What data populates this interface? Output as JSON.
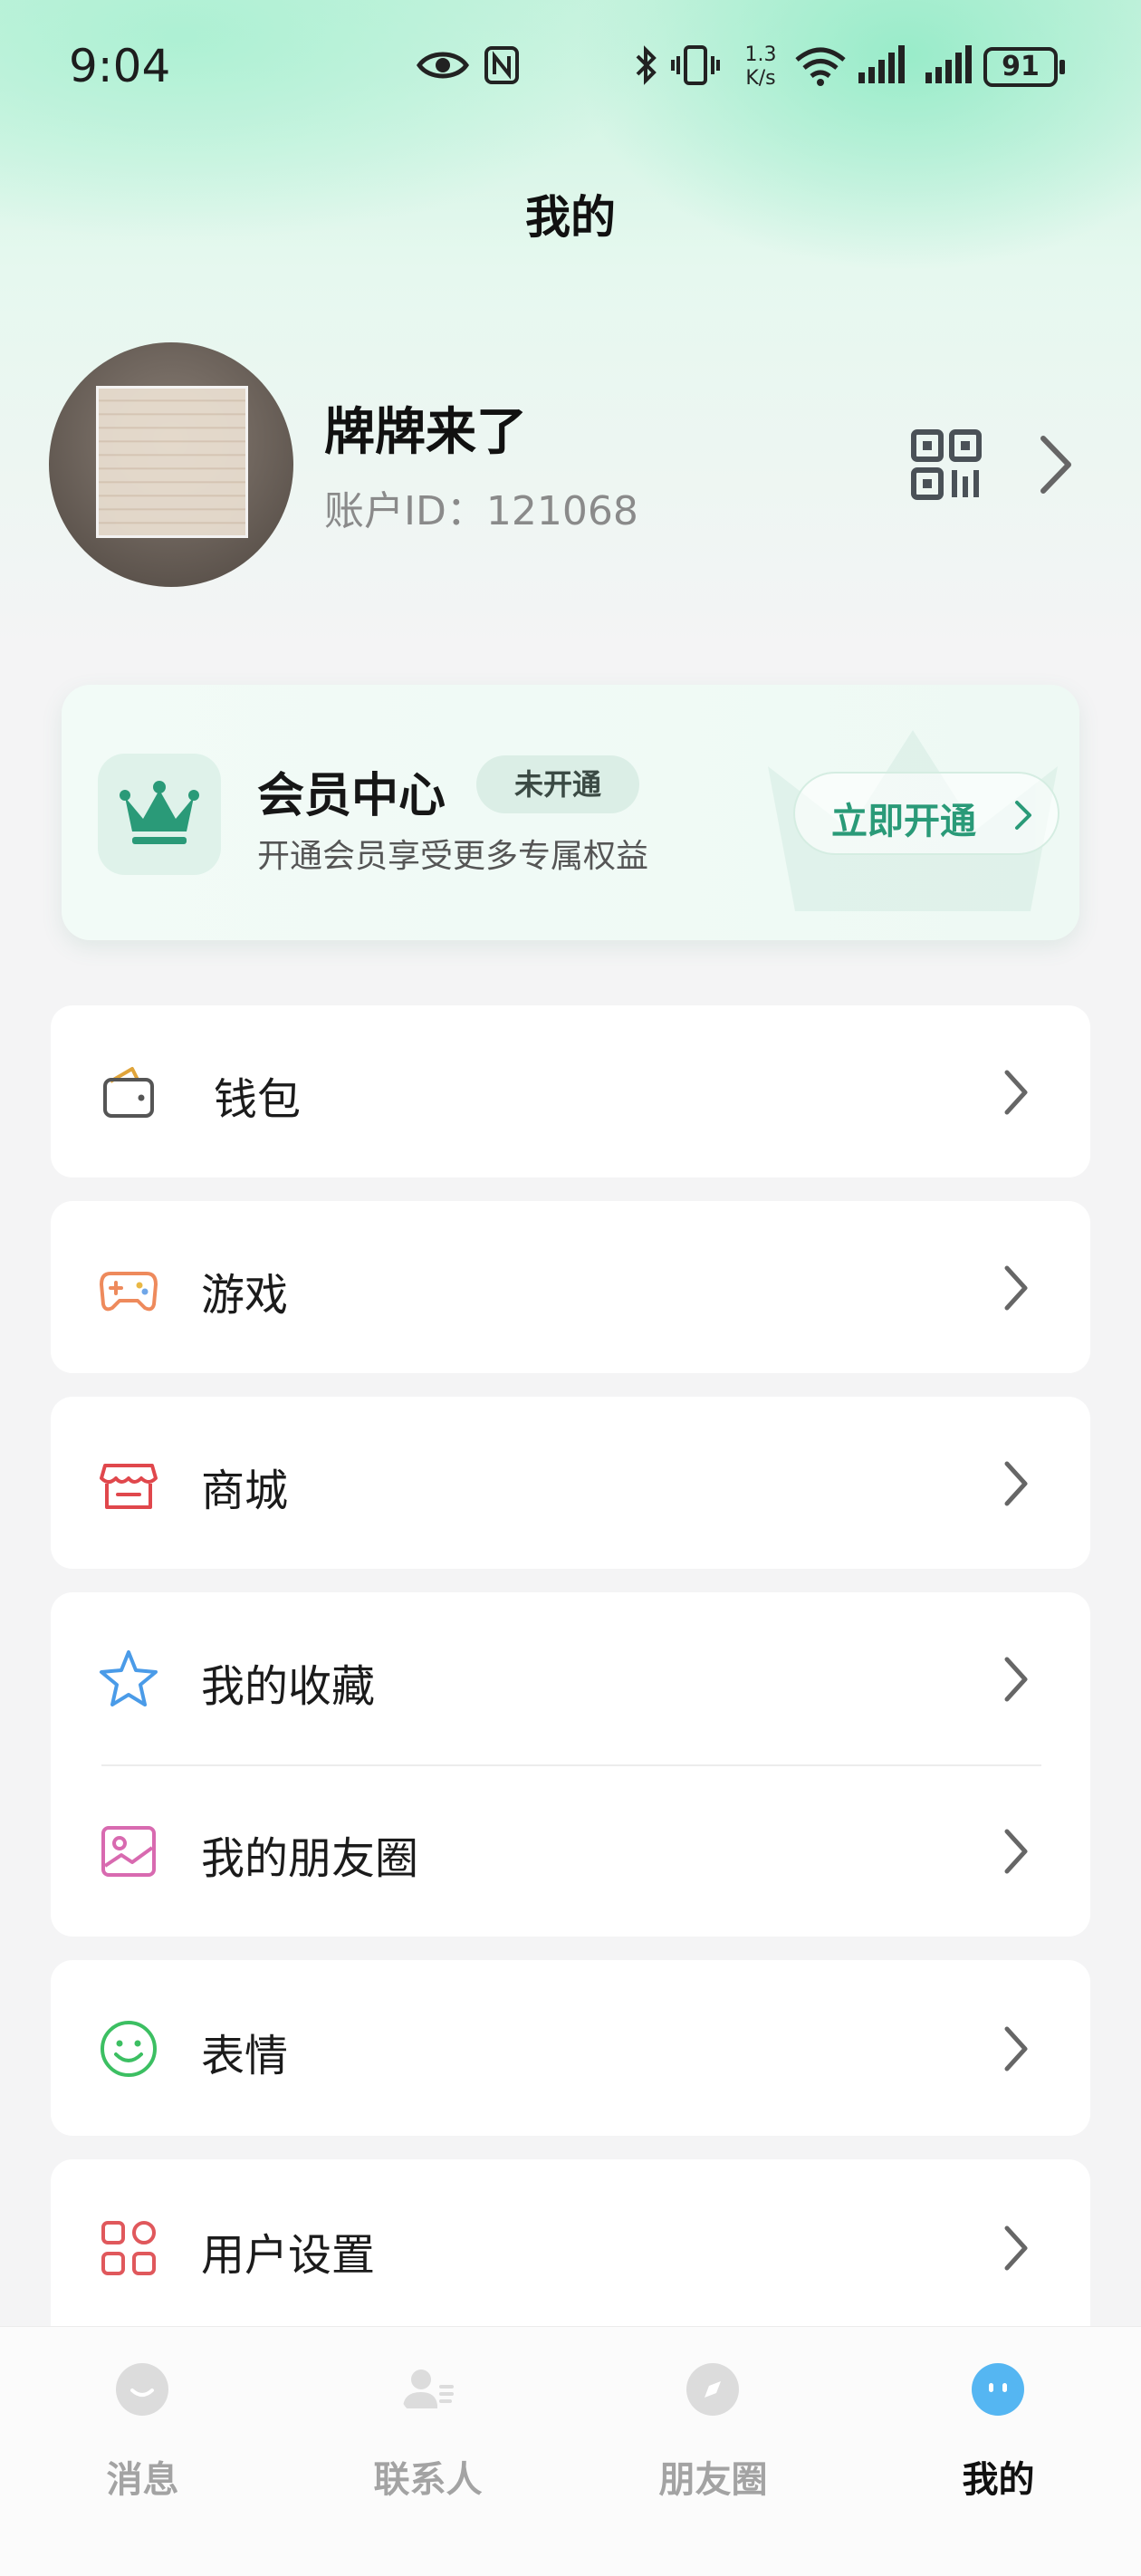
{
  "status_bar": {
    "time": "9:04",
    "net_speed_value": "1.3",
    "net_speed_unit": "K/s",
    "battery": "91"
  },
  "page": {
    "title": "我的"
  },
  "profile": {
    "name": "牌牌来了",
    "account_id": "账户ID：121068"
  },
  "vip": {
    "title": "会员中心",
    "badge": "未开通",
    "subtitle": "开通会员享受更多专属权益",
    "button": "立即开通",
    "accent": "#2a9a78"
  },
  "menu": {
    "wallet": "钱包",
    "games": "游戏",
    "mall": "商城",
    "favorites": "我的收藏",
    "moments": "我的朋友圈",
    "stickers": "表情",
    "settings": "用户设置"
  },
  "bottom_nav": [
    {
      "label": "消息",
      "icon": "message-icon",
      "active": false
    },
    {
      "label": "联系人",
      "icon": "contacts-icon",
      "active": false
    },
    {
      "label": "朋友圈",
      "icon": "compass-icon",
      "active": false
    },
    {
      "label": "我的",
      "icon": "me-icon",
      "active": true
    }
  ]
}
